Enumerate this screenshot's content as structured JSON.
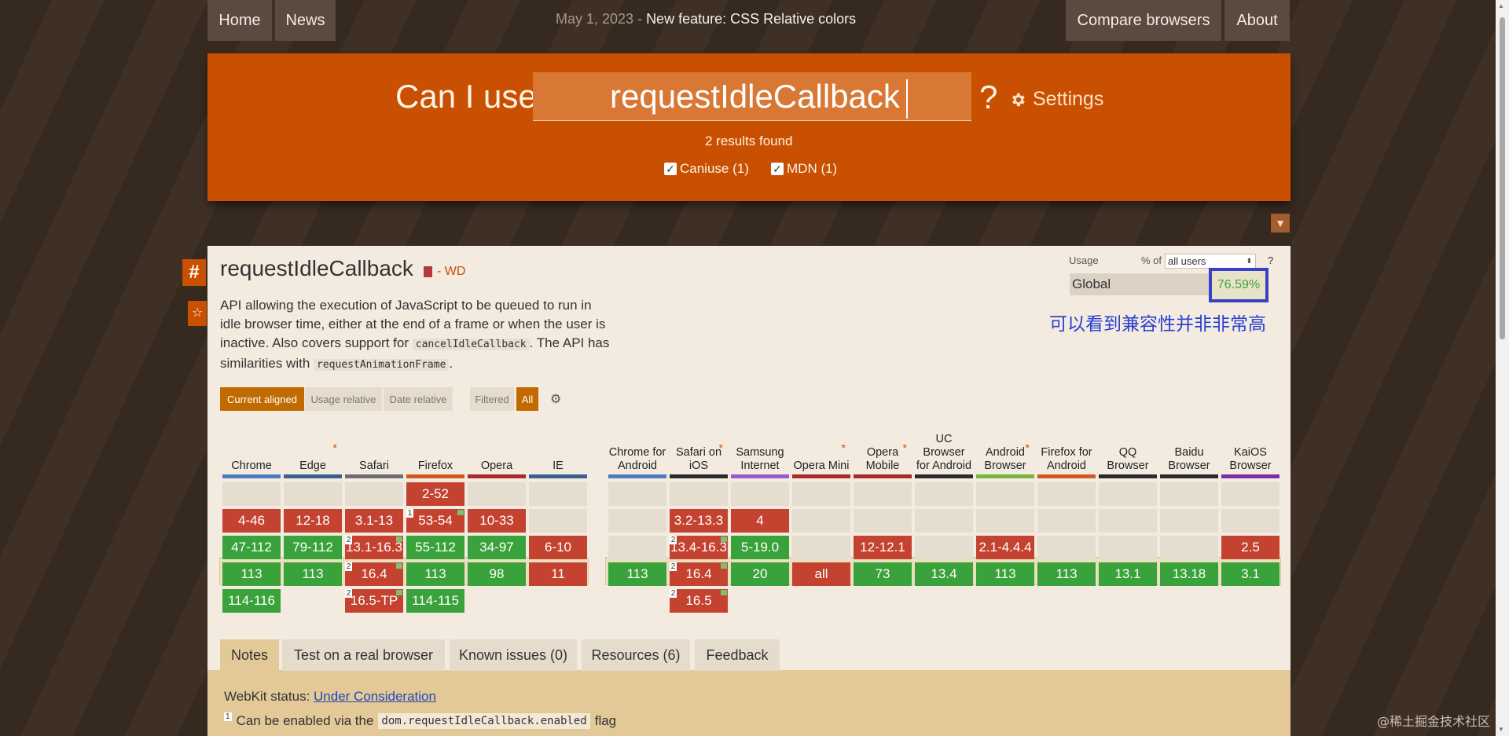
{
  "nav": {
    "home": "Home",
    "news": "News",
    "news_date": "May 1, 2023 - ",
    "news_headline": "New feature: CSS Relative colors",
    "compare": "Compare browsers",
    "about": "About"
  },
  "search": {
    "prefix": "Can I use",
    "query": "requestIdleCallback",
    "suffix": "?",
    "settings": "Settings",
    "results": "2 results found",
    "sources": [
      "Caniuse (1)",
      "MDN (1)"
    ]
  },
  "feature": {
    "title": "requestIdleCallback",
    "status": "- WD",
    "desc_1": "API allowing the execution of JavaScript to be queued to run in idle browser time, either at the end of a frame or when the user is inactive. Also covers support for",
    "code_1": "cancelIdleCallback",
    "desc_2": ". The API has similarities with",
    "code_2": "requestAnimationFrame",
    "desc_3": "."
  },
  "usage": {
    "label": "Usage",
    "pct_of": "% of",
    "scope": "all users",
    "help": "?",
    "region": "Global",
    "value": "76.59%",
    "annotation": "可以看到兼容性并非非常高"
  },
  "view": {
    "current": "Current aligned",
    "relative": "Usage relative",
    "date": "Date relative",
    "filtered": "Filtered",
    "all": "All"
  },
  "browsers": [
    {
      "name": "Chrome",
      "color": "#4e7bbd",
      "ast": false
    },
    {
      "name": "Edge",
      "color": "#3d5f8e",
      "ast": true
    },
    {
      "name": "Safari",
      "color": "#6e6e6e",
      "ast": false
    },
    {
      "name": "Firefox",
      "color": "#d35a1f",
      "ast": false
    },
    {
      "name": "Opera",
      "color": "#a82a2a",
      "ast": false
    },
    {
      "name": "IE",
      "color": "#3d5f8e",
      "ast": false
    },
    {
      "name": "Chrome for Android",
      "color": "#4e7bbd",
      "ast": false
    },
    {
      "name": "Safari on iOS",
      "color": "#2b2b2b",
      "ast": true
    },
    {
      "name": "Samsung Internet",
      "color": "#9b59d0",
      "ast": false
    },
    {
      "name": "Opera Mini",
      "color": "#a82a2a",
      "ast": true
    },
    {
      "name": "Opera Mobile",
      "color": "#a82a2a",
      "ast": true
    },
    {
      "name": "UC Browser for Android",
      "color": "#2b2b2b",
      "ast": false
    },
    {
      "name": "Android Browser",
      "color": "#7bb342",
      "ast": true
    },
    {
      "name": "Firefox for Android",
      "color": "#d35a1f",
      "ast": false
    },
    {
      "name": "QQ Browser",
      "color": "#2b2b2b",
      "ast": false
    },
    {
      "name": "Baidu Browser",
      "color": "#2b2b2b",
      "ast": false
    },
    {
      "name": "KaiOS Browser",
      "color": "#7a2fa8",
      "ast": false
    }
  ],
  "cells": [
    [
      null,
      null,
      null,
      {
        "t": "2-52",
        "s": "r"
      },
      null,
      null,
      null,
      null,
      null,
      null,
      null,
      null,
      null,
      null,
      null,
      null,
      null
    ],
    [
      {
        "t": "4-46",
        "s": "r"
      },
      {
        "t": "12-18",
        "s": "r"
      },
      {
        "t": "3.1-13",
        "s": "r"
      },
      {
        "t": "53-54",
        "s": "r",
        "n": "1",
        "f": true
      },
      {
        "t": "10-33",
        "s": "r"
      },
      null,
      null,
      {
        "t": "3.2-13.3",
        "s": "r"
      },
      {
        "t": "4",
        "s": "r"
      },
      null,
      null,
      null,
      null,
      null,
      null,
      null,
      null
    ],
    [
      {
        "t": "47-112",
        "s": "g"
      },
      {
        "t": "79-112",
        "s": "g"
      },
      {
        "t": "13.1-16.3",
        "s": "r",
        "n": "2",
        "f": true
      },
      {
        "t": "55-112",
        "s": "g"
      },
      {
        "t": "34-97",
        "s": "g"
      },
      {
        "t": "6-10",
        "s": "r"
      },
      null,
      {
        "t": "13.4-16.3",
        "s": "r",
        "n": "2",
        "f": true
      },
      {
        "t": "5-19.0",
        "s": "g"
      },
      null,
      {
        "t": "12-12.1",
        "s": "r"
      },
      null,
      {
        "t": "2.1-4.4.4",
        "s": "r"
      },
      null,
      null,
      null,
      {
        "t": "2.5",
        "s": "r"
      }
    ],
    [
      {
        "t": "113",
        "s": "g"
      },
      {
        "t": "113",
        "s": "g"
      },
      {
        "t": "16.4",
        "s": "r",
        "n": "2",
        "f": true
      },
      {
        "t": "113",
        "s": "g"
      },
      {
        "t": "98",
        "s": "g"
      },
      {
        "t": "11",
        "s": "r"
      },
      {
        "t": "113",
        "s": "g"
      },
      {
        "t": "16.4",
        "s": "r",
        "n": "2",
        "f": true
      },
      {
        "t": "20",
        "s": "g"
      },
      {
        "t": "all",
        "s": "r"
      },
      {
        "t": "73",
        "s": "g"
      },
      {
        "t": "13.4",
        "s": "g"
      },
      {
        "t": "113",
        "s": "g"
      },
      {
        "t": "113",
        "s": "g"
      },
      {
        "t": "13.1",
        "s": "g"
      },
      {
        "t": "13.18",
        "s": "g"
      },
      {
        "t": "3.1",
        "s": "g"
      }
    ],
    [
      {
        "t": "114-116",
        "s": "g"
      },
      null,
      {
        "t": "16.5-TP",
        "s": "r",
        "n": "2",
        "f": true
      },
      {
        "t": "114-115",
        "s": "g"
      },
      null,
      null,
      null,
      {
        "t": "16.5",
        "s": "r",
        "n": "2",
        "f": true
      },
      null,
      null,
      null,
      null,
      null,
      null,
      null,
      null,
      null
    ]
  ],
  "tabs": [
    "Notes",
    "Test on a real browser",
    "Known issues (0)",
    "Resources (6)",
    "Feedback"
  ],
  "notes": {
    "webkit_label": "WebKit status: ",
    "webkit_link": "Under Consideration",
    "note_num": "1",
    "note_text_1": "Can be enabled via the",
    "note_code": "dom.requestIdleCallback.enabled",
    "note_text_2": "flag"
  },
  "watermark": "@稀土掘金技术社区"
}
